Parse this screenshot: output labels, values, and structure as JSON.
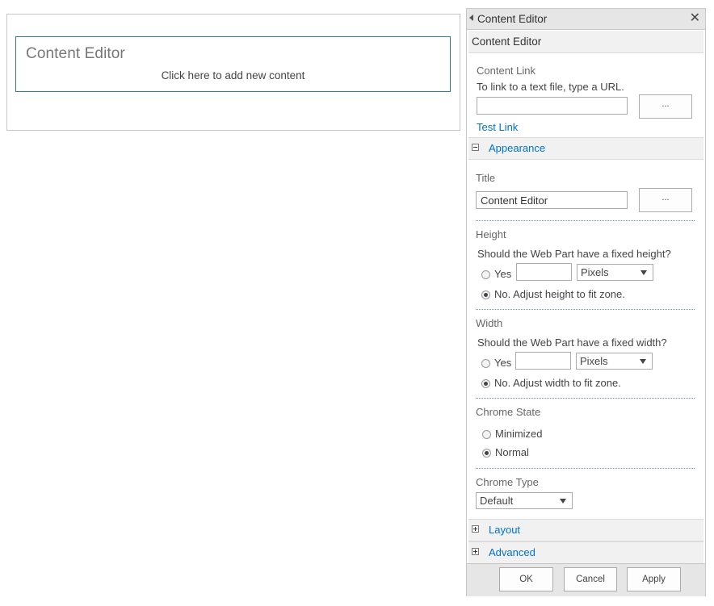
{
  "webpart": {
    "title": "Content Editor",
    "add_content": "Click here to add new content"
  },
  "pane": {
    "header_title": "Content Editor",
    "close_glyph": "✕",
    "part_title": "Content Editor",
    "content_link": {
      "label": "Content Link",
      "hint": "To link to a text file, type a URL.",
      "value": "",
      "browse": "...",
      "test_link": "Test Link"
    },
    "appearance": {
      "label": "Appearance",
      "title_label": "Title",
      "title_value": "Content Editor",
      "title_browse": "...",
      "height": {
        "label": "Height",
        "question": "Should the Web Part have a fixed height?",
        "yes": "Yes",
        "value": "",
        "unit": "Pixels",
        "no": "No. Adjust height to fit zone.",
        "selected": "no"
      },
      "width": {
        "label": "Width",
        "question": "Should the Web Part have a fixed width?",
        "yes": "Yes",
        "value": "",
        "unit": "Pixels",
        "no": "No. Adjust width to fit zone.",
        "selected": "no"
      },
      "chrome_state": {
        "label": "Chrome State",
        "minimized": "Minimized",
        "normal": "Normal",
        "selected": "normal"
      },
      "chrome_type": {
        "label": "Chrome Type",
        "value": "Default"
      }
    },
    "layout_label": "Layout",
    "advanced_label": "Advanced",
    "buttons": {
      "ok": "OK",
      "cancel": "Cancel",
      "apply": "Apply"
    }
  },
  "colors": {
    "link": "#0072c6",
    "webpart_border": "#2a7ab0",
    "header_bg": "#e6e6e6"
  }
}
